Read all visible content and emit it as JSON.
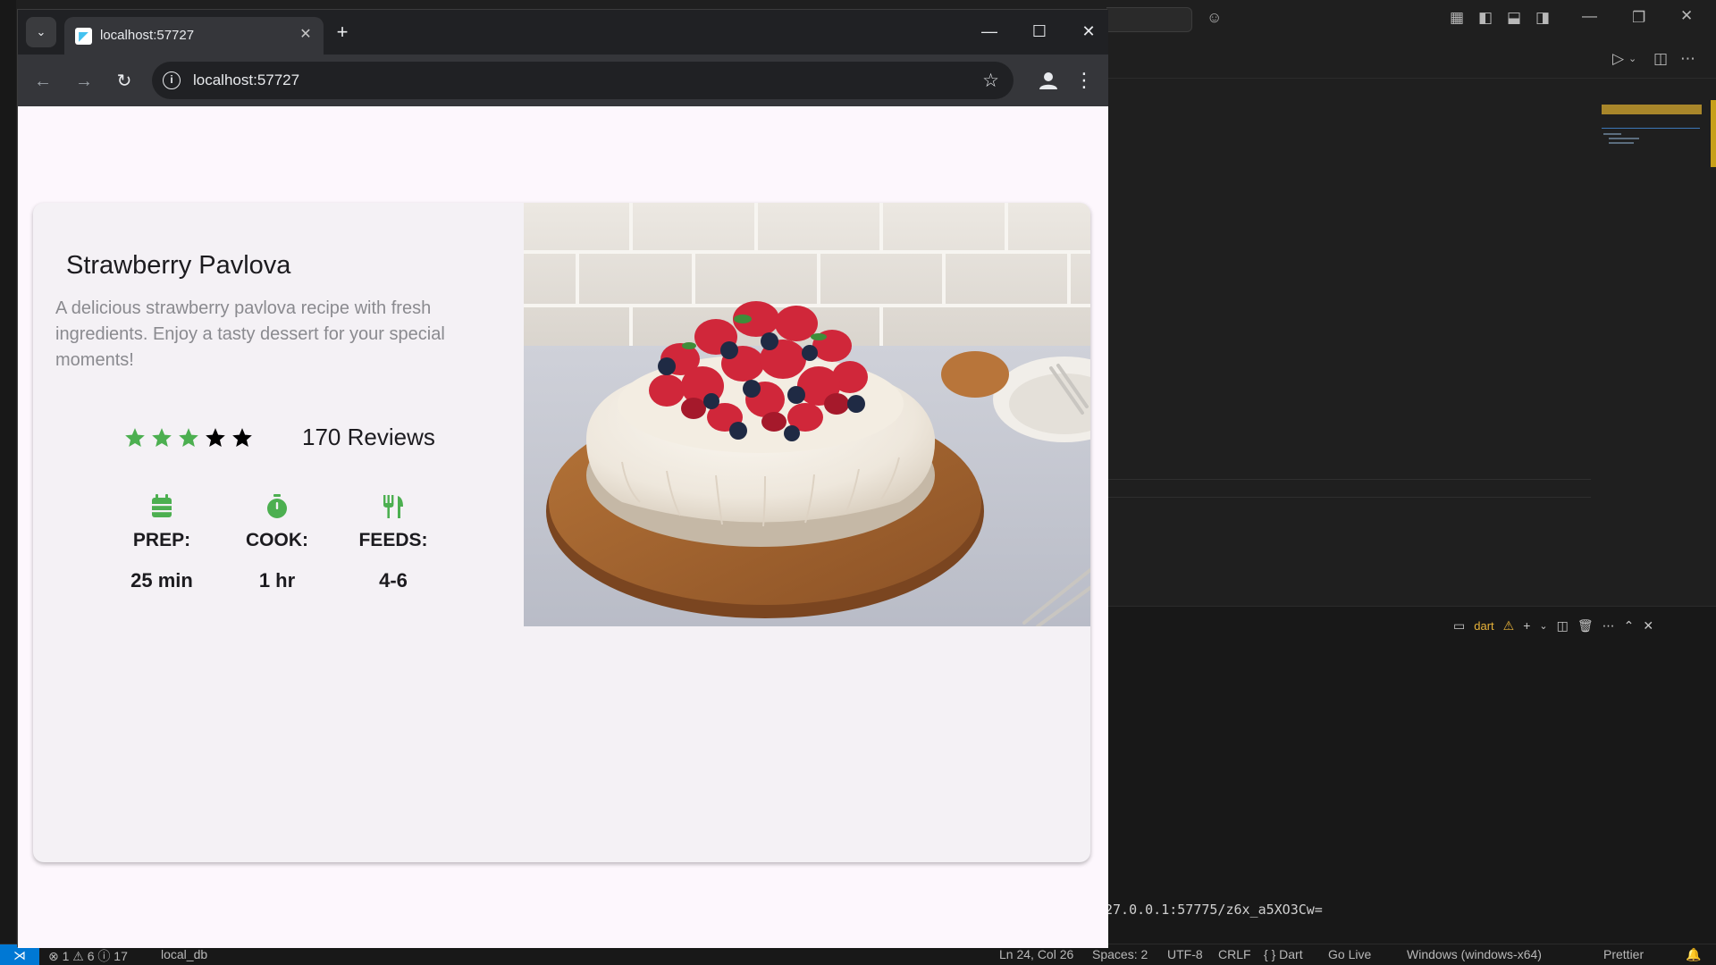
{
  "browser": {
    "tab_title": "localhost:57727",
    "url": "localhost:57727"
  },
  "recipe": {
    "title": "Strawberry Pavlova",
    "description": "A delicious strawberry pavlova recipe with fresh ingredients. Enjoy a tasty dessert for your special moments!",
    "rating": {
      "filled": 3,
      "total": 5
    },
    "reviews_label": "170 Reviews",
    "stats": [
      {
        "icon": "calendar-icon",
        "label": "PREP:",
        "value": "25 min"
      },
      {
        "icon": "timer-icon",
        "label": "COOK:",
        "value": "1 hr"
      },
      {
        "icon": "restaurant-icon",
        "label": "FEEDS:",
        "value": "4-6"
      }
    ],
    "image_alt": "strawberry pavlova with berries on a wooden board"
  },
  "colors": {
    "accent_green": "#4caf50",
    "page_bg": "#fdf7fd",
    "card_bg": "#f4f1f5"
  },
  "vscode": {
    "terminal_tab": "dart",
    "terminal_output": "27.0.0.1:57775/z6x_a5XO3Cw=",
    "status": {
      "problems": "⊗ 1 ⚠ 6 ⓘ 17",
      "db": "local_db",
      "position": "Ln 24, Col 26",
      "spaces": "Spaces: 2",
      "encoding": "UTF-8",
      "eol": "CRLF",
      "language": "{ } Dart",
      "golive": "Go Live",
      "platform": "Windows (windows-x64)",
      "prettier": "Prettier"
    }
  }
}
